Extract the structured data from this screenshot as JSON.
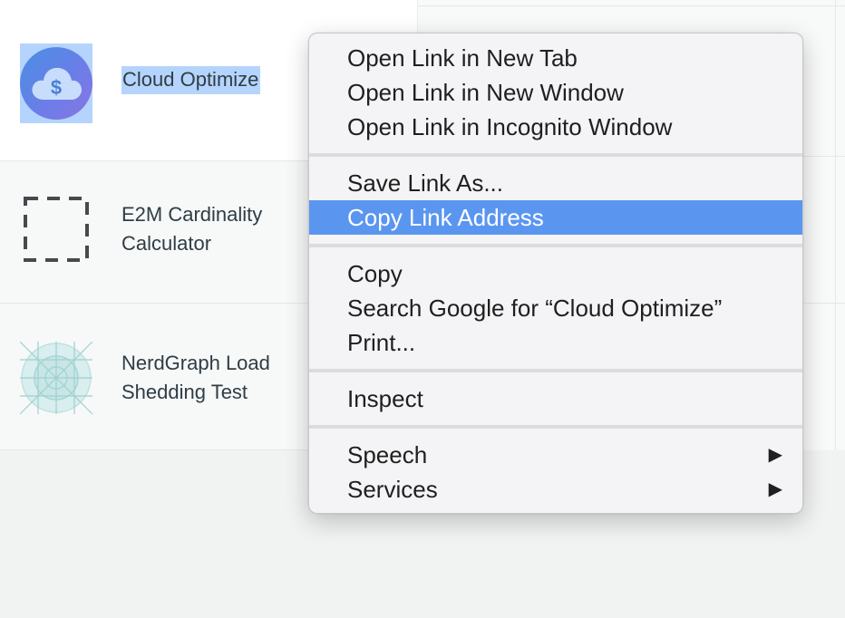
{
  "apps": [
    {
      "name": "Cloud Optimize",
      "icon": "cloud-dollar-icon",
      "selected": true
    },
    {
      "name": "E2M Cardinality Calculator",
      "icon": "dashed-square-icon",
      "selected": false
    },
    {
      "name": "NerdGraph Load Shedding Test",
      "icon": "grid-circle-icon",
      "selected": false
    }
  ],
  "context_menu": {
    "items": [
      {
        "label": "Open Link in New Tab"
      },
      {
        "label": "Open Link in New Window"
      },
      {
        "label": "Open Link in Incognito Window"
      },
      {
        "label": "Save Link As..."
      },
      {
        "label": "Copy Link Address",
        "highlighted": true
      },
      {
        "label": "Copy"
      },
      {
        "label": "Search Google for “Cloud Optimize”"
      },
      {
        "label": "Print..."
      },
      {
        "label": "Inspect"
      },
      {
        "label": "Speech",
        "submenu": true,
        "arrow": "▶"
      },
      {
        "label": "Services",
        "submenu": true,
        "arrow": "▶"
      }
    ]
  },
  "colors": {
    "highlight": "#5a96f0",
    "selection": "#b5d4fd",
    "icon_gradient_start": "#4a8fe4",
    "icon_gradient_end": "#8a74e2"
  }
}
